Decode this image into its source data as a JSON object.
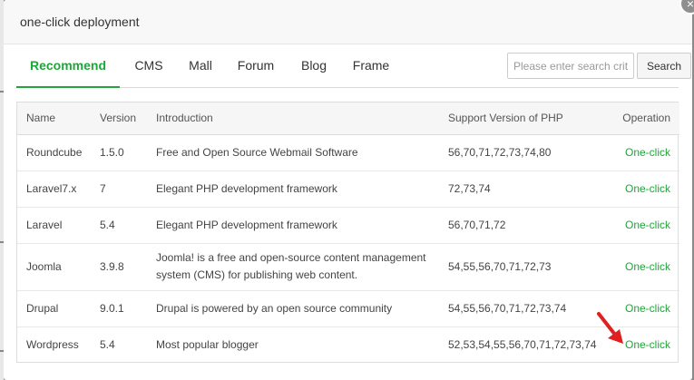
{
  "dialog": {
    "title": "one-click deployment",
    "close_glyph": "×"
  },
  "tabs": [
    {
      "label": "Recommend"
    },
    {
      "label": "CMS"
    },
    {
      "label": "Mall"
    },
    {
      "label": "Forum"
    },
    {
      "label": "Blog"
    },
    {
      "label": "Frame"
    }
  ],
  "search": {
    "placeholder": "Please enter search criteria",
    "button_label": "Search"
  },
  "table": {
    "headers": [
      "Name",
      "Version",
      "Introduction",
      "Support Version of PHP",
      "Operation"
    ],
    "rows": [
      {
        "name": "Roundcube",
        "version": "1.5.0",
        "intro": "Free and Open Source Webmail Software",
        "php": "56,70,71,72,73,74,80",
        "action": "One-click"
      },
      {
        "name": "Laravel7.x",
        "version": "7",
        "intro": "Elegant PHP development framework",
        "php": "72,73,74",
        "action": "One-click"
      },
      {
        "name": "Laravel",
        "version": "5.4",
        "intro": "Elegant PHP development framework",
        "php": "56,70,71,72",
        "action": "One-click"
      },
      {
        "name": "Joomla",
        "version": "3.9.8",
        "intro": "Joomla! is a free and open-source content management system (CMS) for publishing web content.",
        "php": "54,55,56,70,71,72,73",
        "action": "One-click"
      },
      {
        "name": "Drupal",
        "version": "9.0.1",
        "intro": "Drupal is powered by an open source community",
        "php": "54,55,56,70,71,72,73,74",
        "action": "One-click"
      },
      {
        "name": "Wordpress",
        "version": "5.4",
        "intro": "Most popular blogger",
        "php": "52,53,54,55,56,70,71,72,73,74",
        "action": "One-click"
      }
    ]
  },
  "colors": {
    "accent": "#20a53a",
    "annotation_arrow": "#e02020"
  }
}
